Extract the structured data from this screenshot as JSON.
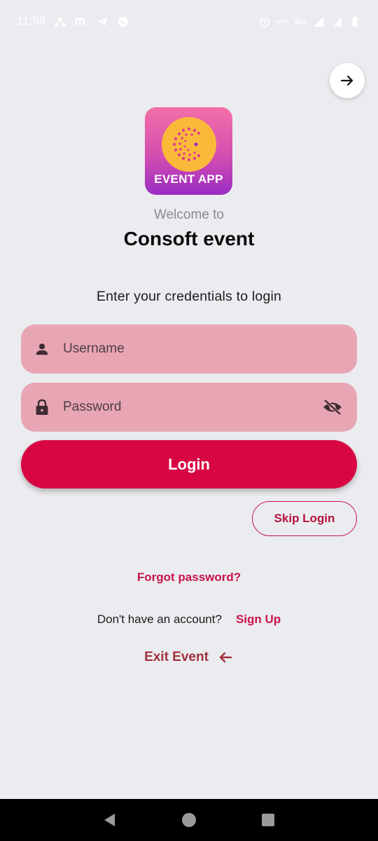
{
  "status_bar": {
    "time": "11:58",
    "left_icons": [
      "share-hub-icon",
      "m-app-icon",
      "telegram-icon",
      "whatsapp-icon"
    ],
    "right_icons": [
      "alarm-icon",
      "volte-icon",
      "signal-icon",
      "signal-icon-2",
      "battery-icon"
    ],
    "network_small": "VoLTE",
    "network_type": "5G+"
  },
  "header": {
    "forward_icon": "arrow-right-icon"
  },
  "logo": {
    "text": "EVENT APP"
  },
  "welcome": {
    "prefix": "Welcome to",
    "title": "Consoft event",
    "subtitle": "Enter your credentials to login"
  },
  "form": {
    "username_placeholder": "Username",
    "password_placeholder": "Password",
    "login_label": "Login",
    "skip_label": "Skip Login"
  },
  "links": {
    "forgot": "Forgot password?",
    "signup_prompt": "Don't have an account?",
    "signup": "Sign Up",
    "exit": "Exit Event"
  },
  "colors": {
    "accent": "#d80744",
    "field_bg": "#e8a6b5",
    "page_bg": "#ebecef",
    "link": "#c8134a",
    "exit": "#a0313c"
  }
}
